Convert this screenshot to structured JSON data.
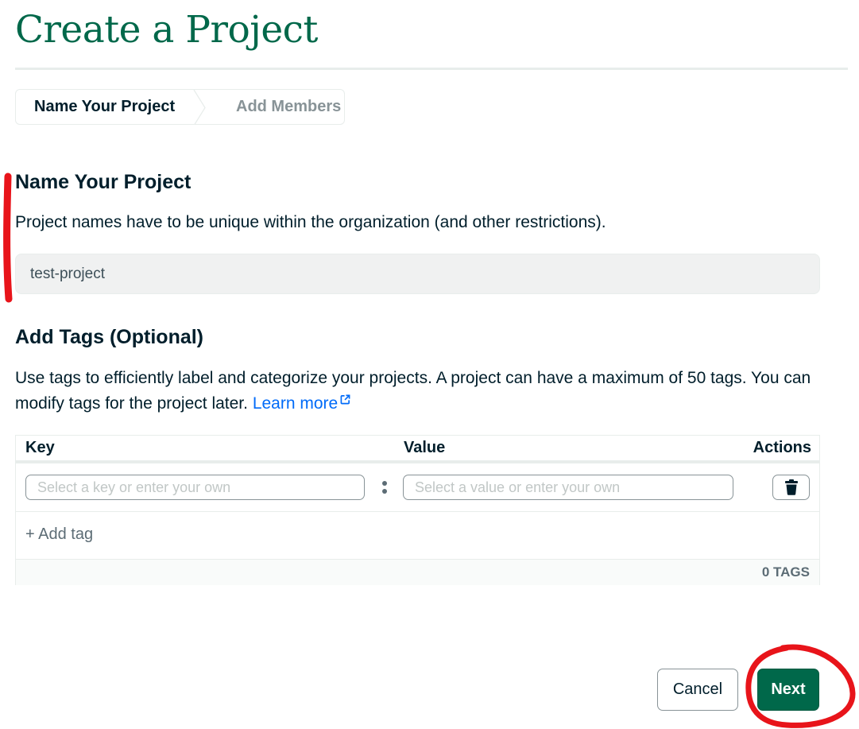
{
  "page": {
    "title": "Create a Project"
  },
  "stepper": {
    "steps": [
      {
        "label": "Name Your Project",
        "state": "active"
      },
      {
        "label": "Add Members",
        "state": "inactive"
      }
    ]
  },
  "name_section": {
    "heading": "Name Your Project",
    "description": "Project names have to be unique within the organization (and other restrictions).",
    "input_value": "test-project"
  },
  "tags_section": {
    "heading": "Add Tags (Optional)",
    "description": "Use tags to efficiently label and categorize your projects. A project can have a maximum of 50 tags. You can modify tags for the project later.",
    "learn_more": "Learn more",
    "table": {
      "columns": {
        "key": "Key",
        "value": "Value",
        "actions": "Actions"
      },
      "key_placeholder": "Select a key or enter your own",
      "value_placeholder": "Select a value or enter your own",
      "add_tag": "+ Add tag",
      "tag_count": "0 TAGS"
    }
  },
  "footer": {
    "cancel_label": "Cancel",
    "next_label": "Next"
  },
  "icons": {
    "delete": "trash-icon",
    "external": "external-link-icon",
    "separator": "colon-separator-icon",
    "step_divider": "chevron-right-icon"
  },
  "colors": {
    "title_green": "#00684a",
    "primary_button": "#00684a",
    "link_blue": "#016bf8",
    "annotation_red": "#e8141a"
  }
}
